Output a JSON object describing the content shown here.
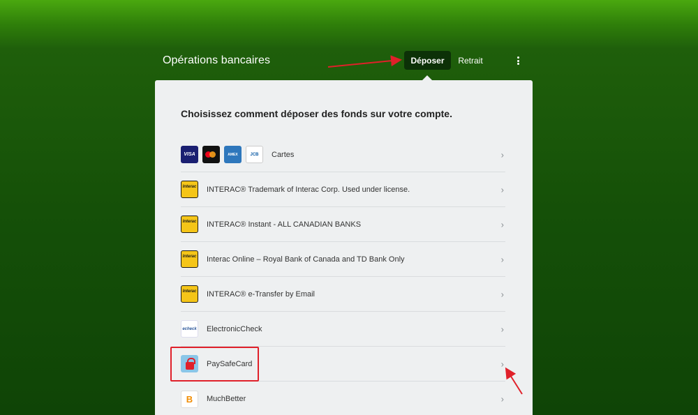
{
  "header": {
    "title": "Opérations bancaires",
    "tabs": [
      {
        "label": "Déposer",
        "active": true
      },
      {
        "label": "Retrait",
        "active": false
      }
    ],
    "menu_icon": "kebab-menu-icon"
  },
  "panel": {
    "heading": "Choisissez comment déposer des fonds sur votre compte.",
    "methods": [
      {
        "label": "Cartes",
        "icons": [
          "visa-logo",
          "mastercard-logo",
          "amex-logo",
          "jcb-logo"
        ]
      },
      {
        "label": "INTERAC® Trademark of Interac Corp. Used under license.",
        "icon": "interac-logo"
      },
      {
        "label": "INTERAC® Instant - ALL CANADIAN BANKS",
        "icon": "interac-logo"
      },
      {
        "label": "Interac Online – Royal Bank of Canada and TD Bank Only",
        "icon": "interac-logo"
      },
      {
        "label": "INTERAC® e-Transfer by Email",
        "icon": "interac-logo"
      },
      {
        "label": "ElectronicCheck",
        "icon": "echeck-logo"
      },
      {
        "label": "PaySafeCard",
        "icon": "paysafecard-logo",
        "highlighted": true
      },
      {
        "label": "MuchBetter",
        "icon": "muchbetter-logo"
      }
    ],
    "chevron": "›"
  },
  "logos": {
    "visa": "VISA",
    "amex": "AMEX",
    "jcb": "JCB",
    "interac": "Interac",
    "echeck": "echeck",
    "muchbetter": "B"
  },
  "colors": {
    "active_tab_bg": "#0c3107",
    "panel_bg": "#eef0f1",
    "annotation_red": "#e0202a"
  }
}
